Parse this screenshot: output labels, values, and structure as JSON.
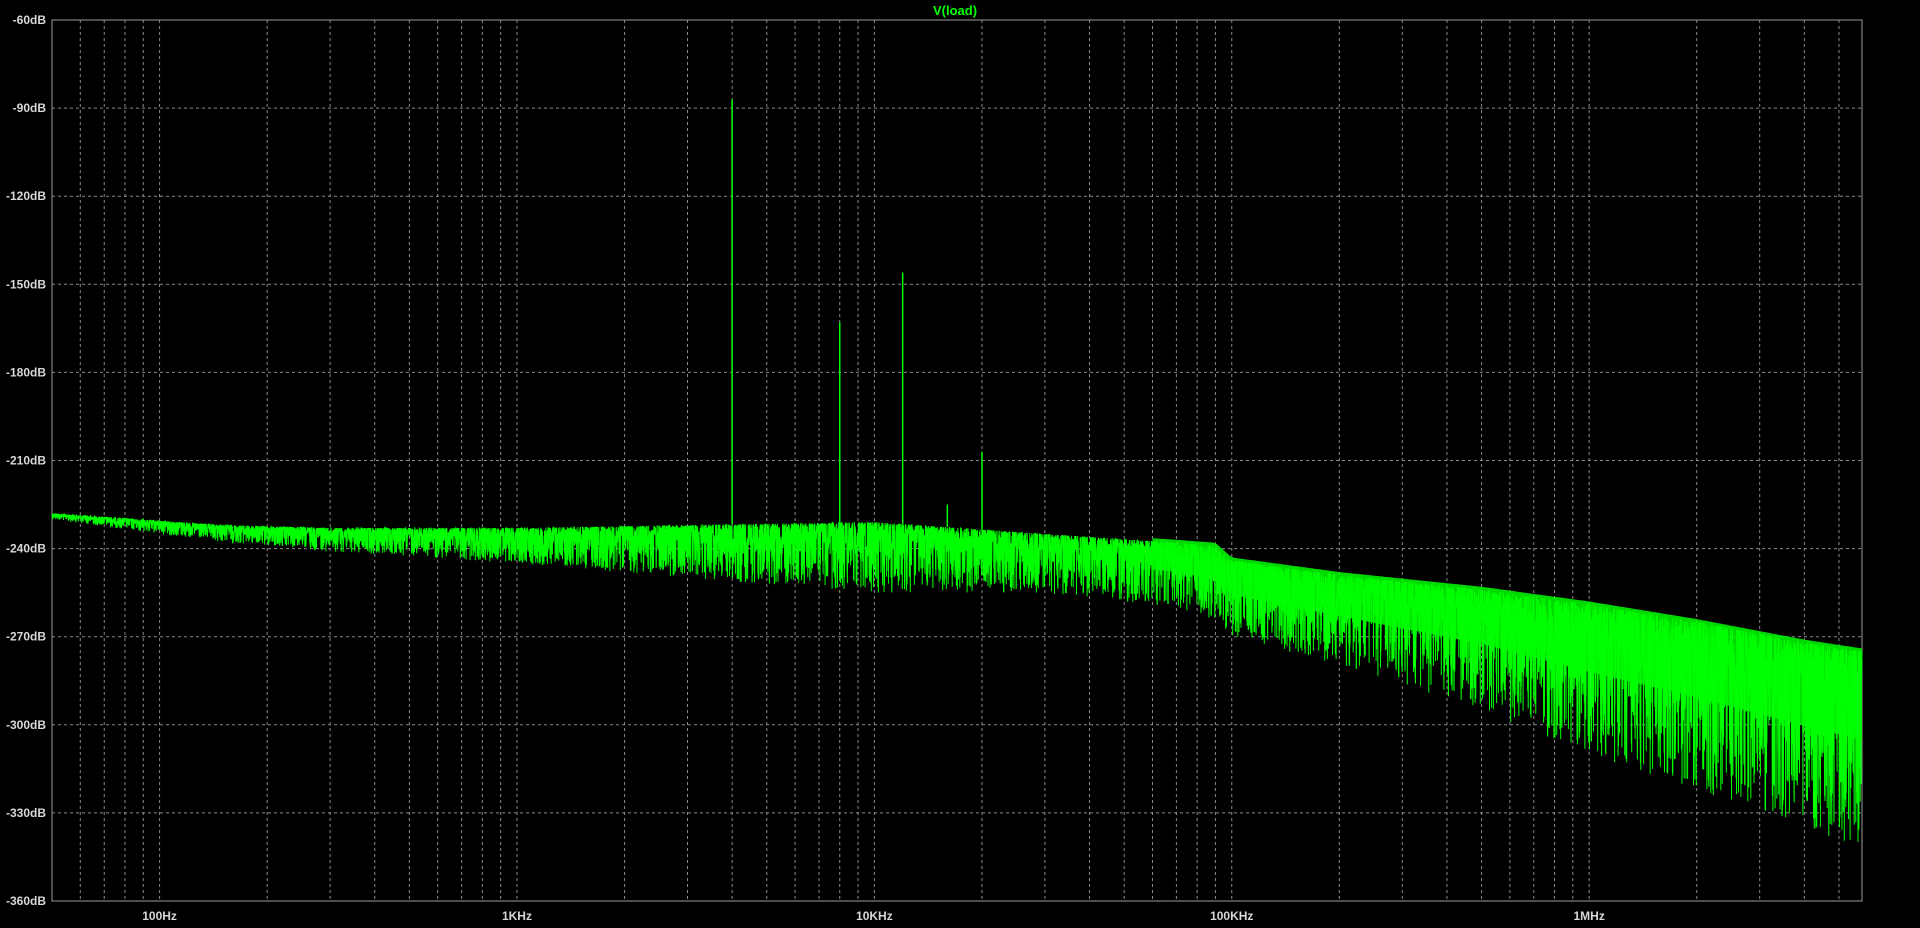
{
  "window": {
    "background_color": "#000000",
    "grid_color": "#8a8a8a",
    "frame_color": "#9a9a9a"
  },
  "chart_data": {
    "type": "line",
    "title": "V(load)",
    "xlabel": "",
    "ylabel": "",
    "x_scale": "log",
    "xlim": [
      50,
      5800000
    ],
    "ylim": [
      -360,
      -60
    ],
    "grid": true,
    "x_tick_labels": [
      {
        "value": 100,
        "label": "100Hz"
      },
      {
        "value": 1000,
        "label": "1KHz"
      },
      {
        "value": 10000,
        "label": "10KHz"
      },
      {
        "value": 100000,
        "label": "100KHz"
      },
      {
        "value": 1000000,
        "label": "1MHz"
      }
    ],
    "y_tick_labels": [
      {
        "value": -60,
        "label": "-60dB"
      },
      {
        "value": -90,
        "label": "-90dB"
      },
      {
        "value": -120,
        "label": "-120dB"
      },
      {
        "value": -150,
        "label": "-150dB"
      },
      {
        "value": -180,
        "label": "-180dB"
      },
      {
        "value": -210,
        "label": "-210dB"
      },
      {
        "value": -240,
        "label": "-240dB"
      },
      {
        "value": -270,
        "label": "-270dB"
      },
      {
        "value": -300,
        "label": "-300dB"
      },
      {
        "value": -330,
        "label": "-330dB"
      },
      {
        "value": -360,
        "label": "-360dB"
      }
    ],
    "series": [
      {
        "color": "#00ff00",
        "description": "noise floor (upper envelope, lower envelope) in dB vs frequency",
        "envelope_freq": [
          50,
          150,
          300,
          1000,
          3000,
          10000,
          30000,
          70000,
          90000,
          100000,
          200000,
          500000,
          1000000,
          2000000,
          4000000,
          5800000
        ],
        "envelope_upper": [
          -228,
          -232,
          -233,
          -233,
          -232,
          -231,
          -235,
          -238,
          -239,
          -244,
          -249,
          -254,
          -259,
          -265,
          -272,
          -275
        ],
        "envelope_lower": [
          -230,
          -238,
          -241,
          -245,
          -250,
          -255,
          -255,
          -260,
          -265,
          -270,
          -280,
          -295,
          -310,
          -322,
          -335,
          -342
        ],
        "peaks": [
          {
            "freq": 4000,
            "db": -87
          },
          {
            "freq": 8000,
            "db": -163
          },
          {
            "freq": 12000,
            "db": -146
          },
          {
            "freq": 16000,
            "db": -225
          },
          {
            "freq": 20000,
            "db": -207
          }
        ]
      }
    ]
  }
}
